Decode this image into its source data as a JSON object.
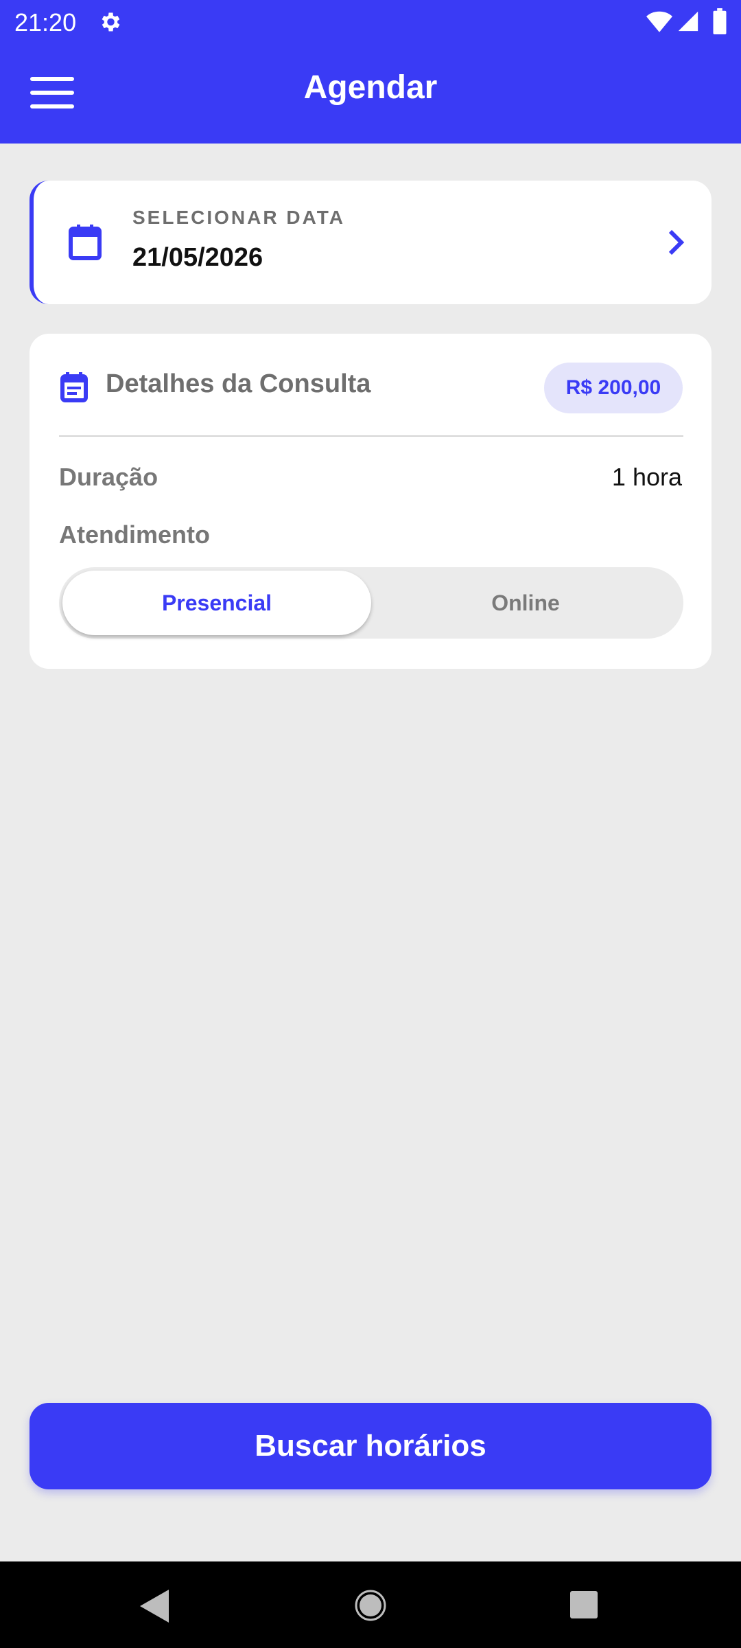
{
  "status_bar": {
    "time": "21:20"
  },
  "app_bar": {
    "title": "Agendar"
  },
  "date_selector": {
    "label": "SELECIONAR DATA",
    "value": "21/05/2026"
  },
  "details": {
    "title": "Detalhes da Consulta",
    "price": "R$ 200,00",
    "duration_label": "Duração",
    "duration_value": "1 hora",
    "attendance_label": "Atendimento",
    "options": [
      {
        "label": "Presencial",
        "selected": true
      },
      {
        "label": "Online",
        "selected": false
      }
    ]
  },
  "cta": {
    "label": "Buscar horários"
  },
  "colors": {
    "accent": "#3a3bf5",
    "background": "#ebebeb",
    "price_chip": "#e4e4fb"
  }
}
